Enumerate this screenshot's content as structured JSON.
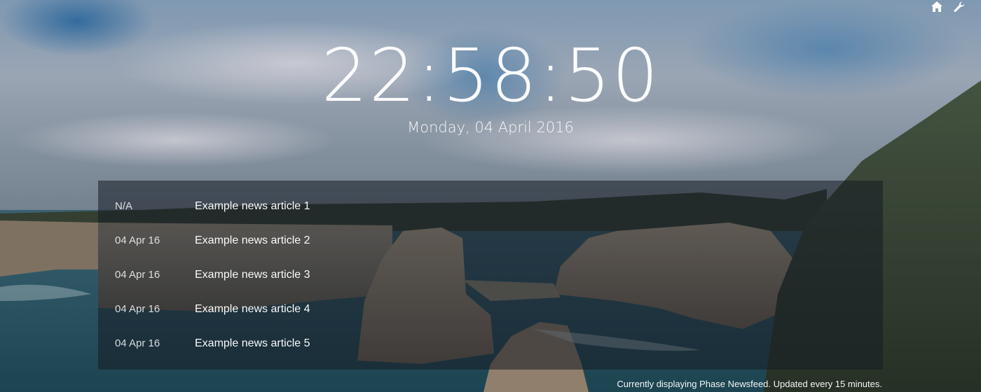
{
  "clock": {
    "time": "22:58:50",
    "date": "Monday, 04 April 2016"
  },
  "toolbar": {
    "icons": [
      "home-icon",
      "wrench-icon"
    ]
  },
  "news": {
    "items": [
      {
        "date": "N/A",
        "title": "Example news article 1"
      },
      {
        "date": "04 Apr 16",
        "title": "Example news article 2"
      },
      {
        "date": "04 Apr 16",
        "title": "Example news article 3"
      },
      {
        "date": "04 Apr 16",
        "title": "Example news article 4"
      },
      {
        "date": "04 Apr 16",
        "title": "Example news article 5"
      }
    ]
  },
  "status": {
    "text": "Currently displaying Phase Newsfeed. Updated every 15 minutes."
  },
  "colors": {
    "sky": "#8fa3b7",
    "sea": "#2f5f70",
    "cliff": "#b8a58c",
    "panel": "#161c24"
  }
}
